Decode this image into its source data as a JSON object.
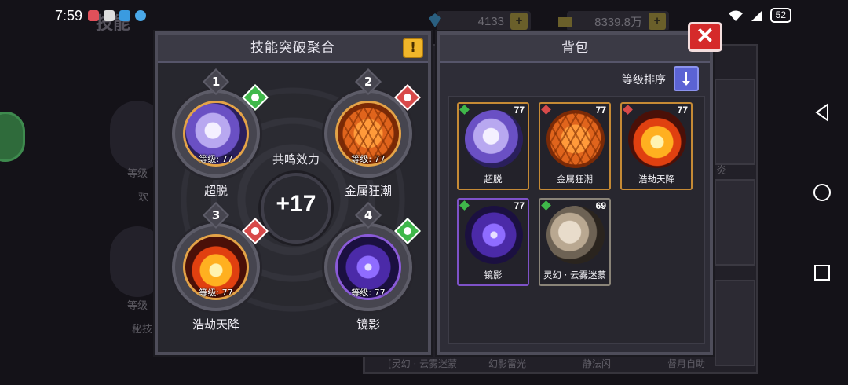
{
  "status_bar": {
    "time": "7:59",
    "battery": "52"
  },
  "background": {
    "title": "技能",
    "gems": "4133",
    "gold": "8339.8万",
    "tab": "背包",
    "left_labels": [
      "等级",
      "欢",
      "等级",
      "秘技"
    ],
    "right_labels": [
      "炎"
    ],
    "bottom_labels": [
      "[灵幻 · 云雾迷蒙",
      "幻影雷光",
      "静法闪",
      "督月自助"
    ]
  },
  "fusion": {
    "title": "技能突破聚合",
    "warn_icon": "!",
    "center_label": "共鸣效力",
    "center_value": "+17",
    "slots": [
      {
        "num": "1",
        "name": "超脱",
        "level": "等级: 77",
        "orb": "crystal",
        "element": "green"
      },
      {
        "num": "2",
        "name": "金属狂潮",
        "level": "等级: 77",
        "orb": "metal",
        "element": "red"
      },
      {
        "num": "3",
        "name": "浩劫天降",
        "level": "等级: 77",
        "orb": "fire",
        "element": "red"
      },
      {
        "num": "4",
        "name": "镜影",
        "level": "等级: 77",
        "orb": "shadow",
        "element": "green"
      }
    ]
  },
  "backpack": {
    "title": "背包",
    "sort_label": "等级排序",
    "items": [
      {
        "name": "超脱",
        "level": "77",
        "orb": "crystal",
        "rarity": "gold",
        "element": "green"
      },
      {
        "name": "金属狂潮",
        "level": "77",
        "orb": "metal",
        "rarity": "gold",
        "element": "red"
      },
      {
        "name": "浩劫天降",
        "level": "77",
        "orb": "fire",
        "rarity": "gold",
        "element": "red"
      },
      {
        "name": "镜影",
        "level": "77",
        "orb": "shadow",
        "rarity": "purple",
        "element": "green"
      },
      {
        "name": "灵幻 · 云雾迷蒙",
        "level": "69",
        "orb": "fog",
        "rarity": "gray",
        "element": "green"
      }
    ]
  },
  "close_label": "✕",
  "colors": {
    "element_green": "#3fb84a",
    "element_red": "#d84a4a",
    "accent_gold": "#f1b62a",
    "close_red": "#d52a2a",
    "sort_blue": "#5b63d4"
  }
}
